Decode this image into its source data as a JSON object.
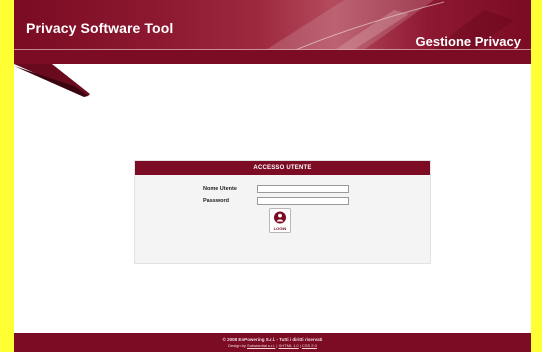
{
  "header": {
    "app_title": "Privacy Software Tool",
    "section_title": "Gestione Privacy"
  },
  "login": {
    "title": "ACCESSO UTENTE",
    "username_label": "Nome Utente",
    "username_value": "",
    "password_label": "Password",
    "password_value": "",
    "login_button_label": "LOGIN",
    "login_icon": "user-icon"
  },
  "footer": {
    "copyright": "© 2008 EnPowering S.r.l. - Tutti i diritti riservati",
    "design_prefix": "Design by",
    "design_link": "Substantial s.r.l.",
    "separator": "|",
    "xhtml_link": "XHTML 1.0",
    "css_link": "CSS 2.0"
  },
  "colors": {
    "brand": "#7c0b24",
    "frame": "#ffff33"
  }
}
